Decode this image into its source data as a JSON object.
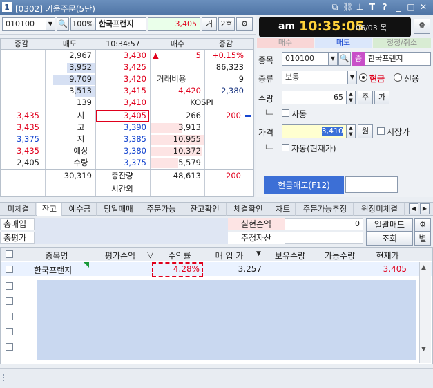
{
  "window": {
    "number": "1",
    "title": "[0302] 키움주문(5단)",
    "icons": [
      "restore-icon",
      "link-icon",
      "pin-icon",
      "text-icon",
      "help-icon",
      "minimize-icon",
      "maximize-icon",
      "close-icon"
    ]
  },
  "toolbar": {
    "code": "010100",
    "pct": "100%",
    "stock_name": "한국프랜지",
    "price": "3,405",
    "btn_geo": "거",
    "btn_hoga": "2호"
  },
  "clock": {
    "ampm": "am",
    "time": "10:35:05",
    "date": "06/03 목"
  },
  "hoga": {
    "headers": [
      "증감",
      "매도",
      "10:34:57",
      "매수",
      "증감"
    ],
    "ask_rows": [
      {
        "qty": "2,967",
        "price": "3,430"
      },
      {
        "qty": "3,952",
        "price": "3,425"
      },
      {
        "qty": "9,709",
        "price": "3,420"
      },
      {
        "qty": "3,513",
        "price": "3,415"
      },
      {
        "qty": "139",
        "price": "3,410"
      }
    ],
    "info": {
      "change_arrow": "▲",
      "change": "5",
      "change_pct": "+0.15%",
      "volume": "86,323",
      "cost_label": "거래비용",
      "cost_val": "9",
      "v1": "4,420",
      "v2": "2,380",
      "kospi_label": "KOSPI"
    },
    "side_labels": [
      {
        "val": "3,435",
        "label": "시"
      },
      {
        "val": "3,435",
        "label": "고"
      },
      {
        "val": "3,375",
        "label": "저"
      },
      {
        "val": "3,435",
        "label": "예상"
      },
      {
        "val": "2,405",
        "label": "수량"
      }
    ],
    "bid_rows": [
      {
        "price": "3,405",
        "qty": "266",
        "chg": "200"
      },
      {
        "price": "3,390",
        "qty": "3,913",
        "chg": ""
      },
      {
        "price": "3,385",
        "qty": "10,955",
        "chg": ""
      },
      {
        "price": "3,380",
        "qty": "10,372",
        "chg": ""
      },
      {
        "price": "3,375",
        "qty": "5,579",
        "chg": ""
      }
    ],
    "total": {
      "ask": "30,319",
      "label": "총잔량",
      "bid": "48,613",
      "chg": "200"
    },
    "after_label": "시간외"
  },
  "order": {
    "tabs": [
      "매수",
      "매도",
      "정정/취소"
    ],
    "code_label": "종목",
    "code": "010100",
    "stock_name": "한국프랜지",
    "type_label": "종류",
    "type": "보통",
    "cash": "현금",
    "credit": "신용",
    "qty_label": "수량",
    "qty": "65",
    "qty_btn1": "주",
    "qty_btn2": "가",
    "auto": "자동",
    "price_label": "가격",
    "price": "3,410",
    "price_unit": "원",
    "market_price": "시장가",
    "auto_current": "자동(현재가)",
    "sell_button": "현금매도(F12)"
  },
  "tabs": [
    "미체결",
    "잔고",
    "예수금",
    "당일매매",
    "주문가능",
    "잔고확인",
    "체결확인",
    "차트",
    "주문가능추정",
    "원장미체결"
  ],
  "summary": {
    "buy_total": "총매입",
    "eval_total": "총평가",
    "realized": "실현손익",
    "realized_val": "0",
    "est_asset": "추정자산",
    "bulk_sell": "일괄매도",
    "inquiry": "조회",
    "separate": "별"
  },
  "grid": {
    "headers": [
      "종목명",
      "평가손익",
      "수익률",
      "매 입 가",
      "보유수량",
      "가능수량",
      "현재가"
    ],
    "rows": [
      {
        "name": "한국프랜지",
        "profit": "",
        "rate": "4.28%",
        "buy_price": "3,257",
        "hold": "",
        "avail": "",
        "current": "3,405"
      }
    ]
  }
}
